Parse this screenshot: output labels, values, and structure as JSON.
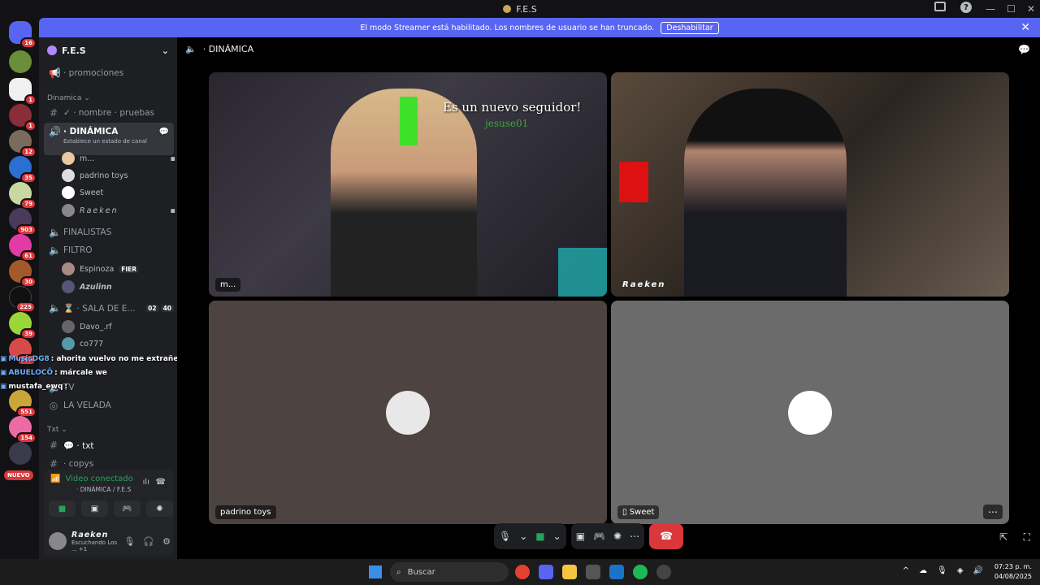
{
  "window": {
    "title": "F.E.S"
  },
  "banner": {
    "text": "El modo Streamer está habilitado. Los nombres de usuario se han truncado.",
    "button": "Deshabilitar"
  },
  "guild": {
    "name": "F.E.S"
  },
  "channels": {
    "promociones": "· promociones",
    "category_dinamica": "Dinamica ⌄",
    "nombre_pruebas": "✓ · nombre · pruebas",
    "dinamica": "· DINÁMICA",
    "dinamica_sub": "Establece un estado de canal",
    "finalistas": "FINALISTAS",
    "filtro": "FILTRO",
    "sala": "⌛ · SALA DE E...",
    "sala_count1": "02",
    "sala_count2": "40",
    "tv": "TV",
    "la_velada": "LA VELADA",
    "category_txt": "Txt ⌄",
    "txt": "💬 · txt",
    "copys": "· copys"
  },
  "members": {
    "dinamica": [
      "m...",
      "padrino toys",
      "Sweet",
      "Raeken"
    ],
    "filtro": [
      {
        "name": "Espinoza",
        "tag": "FIER"
      },
      {
        "name": "Azulinn"
      }
    ],
    "sala": [
      "Davo_.rf"
    ],
    "extra": "co777"
  },
  "chat_overlay": [
    {
      "user": "MusicDG8",
      "text": ": ahorita vuelvo no me extrañen ando chambeando"
    },
    {
      "user": "ABUELOCÖ",
      "text": ": márcale we"
    },
    {
      "user": "mustafa_ewq",
      "text": ":"
    }
  ],
  "voice_panel": {
    "status": "Video conectado",
    "channel": "· DINÁMICA / F.E.S",
    "user": "Raeken",
    "activity": "Escuchando Los ...",
    "activity_more": "+1"
  },
  "call": {
    "header": "· DINÁMICA",
    "tiles": [
      {
        "label": "m...",
        "overlay_title": "Es un nuevo seguidor!",
        "overlay_sub": "jesuse01"
      },
      {
        "label": "Raeken"
      },
      {
        "label": "padrino toys"
      },
      {
        "label": "Sweet"
      }
    ]
  },
  "server_badges": [
    "16",
    "1",
    "1",
    "12",
    "35",
    "79",
    "903",
    "61",
    "30",
    "225",
    "39",
    "163",
    "551",
    "154"
  ],
  "nuevo": "NUEVO",
  "taskbar": {
    "search": "Buscar",
    "time": "07:23 p. m.",
    "date": "04/08/2025"
  },
  "colors": {
    "blurple": "#5865f2",
    "red": "#da373c",
    "green": "#23a55a"
  }
}
